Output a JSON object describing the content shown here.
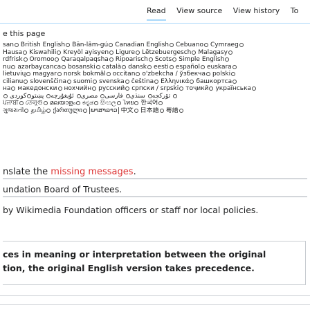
{
  "tabs": [
    "Read",
    "View source",
    "View history",
    "To"
  ],
  "page_note": "e this page",
  "languages": [
    [
      {
        "name": "san",
        "radio": "right",
        "sel": false
      },
      {
        "name": "British English",
        "radio": "right",
        "sel": false
      },
      {
        "name": "Bān-lâm-gú",
        "radio": "right",
        "sel": false
      },
      {
        "name": "Canadian English",
        "radio": "right",
        "sel": false
      },
      {
        "name": "Cebuano",
        "radio": "right",
        "sel": false
      },
      {
        "name": "Cymraeg",
        "radio": "right",
        "sel": false
      }
    ],
    [
      {
        "name": "Hausa",
        "radio": "right",
        "sel": false
      },
      {
        "name": "Kiswahili",
        "radio": "right",
        "sel": false
      },
      {
        "name": "Kreyòl ayisyen",
        "radio": "right",
        "sel": false
      },
      {
        "name": "Ligure",
        "radio": "right",
        "sel": false
      },
      {
        "name": "Lëtzebuergesch",
        "radio": "right",
        "sel": false
      },
      {
        "name": "Malagasy",
        "radio": "right",
        "sel": false
      }
    ],
    [
      {
        "name": "rdfrisk",
        "radio": "right",
        "sel": false
      },
      {
        "name": "Oromoo",
        "radio": "right",
        "sel": false
      },
      {
        "name": "Qaraqalpaqsha",
        "radio": "right",
        "sel": false
      },
      {
        "name": "Ripoarisch",
        "radio": "right",
        "sel": false
      },
      {
        "name": "Scots",
        "radio": "right",
        "sel": false
      },
      {
        "name": "Simple English",
        "radio": "right",
        "sel": false
      }
    ],
    [
      {
        "name": "nu",
        "radio": "right",
        "sel": false
      },
      {
        "name": "azərbaycanca",
        "radio": "right",
        "sel": false
      },
      {
        "name": "bosanski",
        "radio": "right",
        "sel": false
      },
      {
        "name": "català",
        "radio": "right",
        "sel": false
      },
      {
        "name": "dansk",
        "radio": "right",
        "sel": false
      },
      {
        "name": "eesti",
        "radio": "right",
        "sel": false
      },
      {
        "name": "español",
        "radio": "right",
        "sel": false
      },
      {
        "name": "euskara",
        "radio": "right",
        "sel": false
      }
    ],
    [
      {
        "name": "lietuvių",
        "radio": "right",
        "sel": false
      },
      {
        "name": "magyar",
        "radio": "right",
        "sel": false
      },
      {
        "name": "norsk bokmål",
        "radio": "right",
        "sel": false
      },
      {
        "name": "occitan",
        "radio": "right",
        "sel": false
      },
      {
        "name": "o'zbekcha / ўзбекча",
        "radio": "right",
        "sel": false
      },
      {
        "name": "polski",
        "radio": "right",
        "sel": false
      }
    ],
    [
      {
        "name": "cilianu",
        "radio": "right",
        "sel": false
      },
      {
        "name": "slovenščina",
        "radio": "right",
        "sel": false
      },
      {
        "name": "suomi",
        "radio": "right",
        "sel": false
      },
      {
        "name": "svenska",
        "radio": "right",
        "sel": false
      },
      {
        "name": "čeština",
        "radio": "right",
        "sel": false
      },
      {
        "name": "Ελληνικά",
        "radio": "right",
        "sel": false
      },
      {
        "name": "башкортса",
        "radio": "right",
        "sel": false
      }
    ],
    [
      {
        "name": "на",
        "radio": "right",
        "sel": false
      },
      {
        "name": "македонски",
        "radio": "right",
        "sel": false
      },
      {
        "name": "нохчийн",
        "radio": "right",
        "sel": false
      },
      {
        "name": "русский",
        "radio": "right",
        "sel": false
      },
      {
        "name": "српски / srpski",
        "radio": "right",
        "sel": false
      },
      {
        "name": "тоҷикӣ",
        "radio": "right",
        "sel": false
      },
      {
        "name": "українська",
        "radio": "right",
        "sel": false
      }
    ],
    [
      {
        "name": "",
        "radio": "right",
        "sel": false
      },
      {
        "name": "تۆرکجه",
        "radio": "right",
        "sel": false
      },
      {
        "name": "سنڌي",
        "radio": "right",
        "sel": false
      },
      {
        "name": "فارسی",
        "radio": "right",
        "sel": false
      },
      {
        "name": "مصرى",
        "radio": "right",
        "sel": false
      },
      {
        "name": "ئۇيغۇرچە",
        "radio": "right",
        "sel": false
      },
      {
        "name": "پښتو",
        "radio": "right",
        "sel": false
      },
      {
        "name": "کوردی",
        "radio": "right",
        "sel": false
      }
    ],
    [
      {
        "name": "ਪੰਜਾਬੀ",
        "radio": "right",
        "sel": false
      },
      {
        "name": "তেলুগু",
        "radio": "right",
        "sel": false
      },
      {
        "name": "മലയാളം",
        "radio": "right",
        "sel": false
      },
      {
        "name": "ಕನ್ನಡ",
        "radio": "right",
        "sel": false
      },
      {
        "name": "සිංහල",
        "radio": "right",
        "sel": false
      },
      {
        "name": "ไทย",
        "radio": "right",
        "sel": false
      },
      {
        "name": "한국어",
        "radio": "right",
        "sel": false
      }
    ],
    [
      {
        "name": "ગુજરાતી",
        "radio": "right",
        "sel": false
      },
      {
        "name": "தமிழ்",
        "radio": "right",
        "sel": false
      },
      {
        "name": "ქართული",
        "radio": "right",
        "sel": false
      },
      {
        "name": "ພາສາລາວ",
        "radio": "none",
        "sel": true
      },
      {
        "name": "中文",
        "radio": "right",
        "sel": false
      },
      {
        "name": "日本語",
        "radio": "right",
        "sel": false
      },
      {
        "name": "粵語",
        "radio": "right",
        "sel": false
      }
    ]
  ],
  "heading1": {
    "pre": "nslate the ",
    "link": "missing messages",
    "post": "."
  },
  "para1": "undation Board of Trustees.",
  "para2": "by Wikimedia Foundation officers or staff nor local policies.",
  "para3a": "ces in meaning or interpretation between the original",
  "para3b": "tion, the original English version takes precedence."
}
